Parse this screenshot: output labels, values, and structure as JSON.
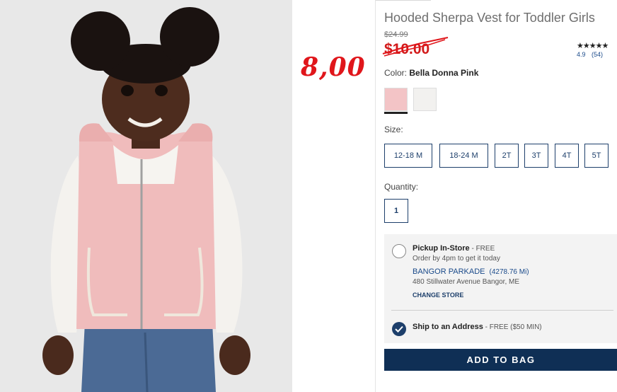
{
  "overlay": {
    "handwritten_price": "8,00"
  },
  "product": {
    "title": "Hooded Sherpa Vest for Toddler Girls",
    "original_price": "$24.99",
    "sale_price": "$10.00",
    "rating": {
      "stars": "★★★★★",
      "score": "4.9",
      "count": "(54)"
    }
  },
  "color": {
    "label": "Color:",
    "selected": "Bella Donna Pink",
    "swatches": [
      {
        "name": "Bella Donna Pink",
        "color": "#f3c4c6",
        "selected": true
      },
      {
        "name": "Cream",
        "color": "#f2f1ef",
        "selected": false
      }
    ]
  },
  "size": {
    "label": "Size:",
    "options": [
      "12-18 M",
      "18-24 M",
      "2T",
      "3T",
      "4T",
      "5T"
    ]
  },
  "quantity": {
    "label": "Quantity:",
    "value": "1"
  },
  "fulfillment": {
    "pickup": {
      "title": "Pickup In-Store",
      "price": " - FREE",
      "note": "Order by 4pm to get it today",
      "store_name": "BANGOR PARKADE",
      "store_distance": "(4278.76 Mi)",
      "store_address": "480 Stillwater Avenue Bangor, ME",
      "change_store": "CHANGE STORE"
    },
    "ship": {
      "title": "Ship to an Address",
      "price": " - FREE ($50 MIN)"
    }
  },
  "add_to_bag": "ADD TO BAG",
  "colors": {
    "brand_navy": "#0f2f55",
    "sale_red": "#d21a1a",
    "overlay_red": "#e0161b"
  }
}
